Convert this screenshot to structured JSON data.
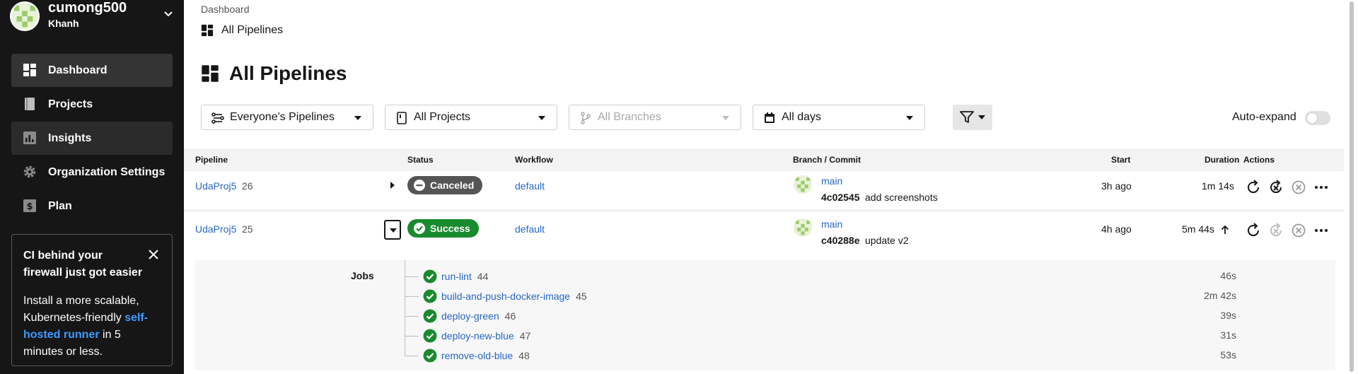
{
  "sidebar": {
    "org_name": "cumong500",
    "org_sub": "Khanh",
    "nav": [
      {
        "label": "Dashboard"
      },
      {
        "label": "Projects"
      },
      {
        "label": "Insights"
      },
      {
        "label": "Organization Settings"
      },
      {
        "label": "Plan"
      }
    ],
    "promo": {
      "title": "CI behind your firewall just got easier",
      "body_before": "Install a more scalable, Kubernetes-friendly ",
      "link": "self-hosted runner",
      "body_after": " in 5 minutes or less."
    }
  },
  "header": {
    "breadcrumb": "Dashboard",
    "subtitle": "All Pipelines",
    "title": "All Pipelines"
  },
  "filters": {
    "pipelines": "Everyone's Pipelines",
    "projects": "All Projects",
    "branches": "All Branches",
    "days": "All days",
    "auto_expand": "Auto-expand"
  },
  "table": {
    "headers": {
      "pipeline": "Pipeline",
      "status": "Status",
      "workflow": "Workflow",
      "branch": "Branch / Commit",
      "start": "Start",
      "duration": "Duration",
      "actions": "Actions"
    },
    "rows": [
      {
        "project": "UdaProj5",
        "number": "26",
        "status": "Canceled",
        "workflow": "default",
        "branch": "main",
        "commit_hash": "4c02545",
        "commit_msg": "add screenshots",
        "start": "3h ago",
        "duration": "1m 14s"
      },
      {
        "project": "UdaProj5",
        "number": "25",
        "status": "Success",
        "workflow": "default",
        "branch": "main",
        "commit_hash": "c40288e",
        "commit_msg": "update v2",
        "start": "4h ago",
        "duration": "5m 44s"
      }
    ],
    "jobs_label": "Jobs",
    "jobs": [
      {
        "name": "run-lint",
        "number": "44",
        "duration": "46s"
      },
      {
        "name": "build-and-push-docker-image",
        "number": "45",
        "duration": "2m 42s"
      },
      {
        "name": "deploy-green",
        "number": "46",
        "duration": "39s"
      },
      {
        "name": "deploy-new-blue",
        "number": "47",
        "duration": "31s"
      },
      {
        "name": "remove-old-blue",
        "number": "48",
        "duration": "53s"
      }
    ]
  },
  "colors": {
    "sidebar_bg": "#161616",
    "link": "#2566c3",
    "success": "#1a8a2e",
    "canceled": "#555555",
    "promo_link": "#3d9bff"
  }
}
